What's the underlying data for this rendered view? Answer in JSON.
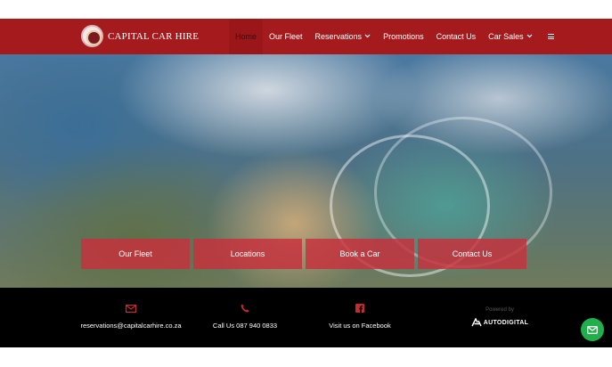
{
  "header": {
    "brand_name": "CAPITAL CAR HIRE",
    "nav": [
      {
        "label": "Home",
        "active": true
      },
      {
        "label": "Our Fleet"
      },
      {
        "label": "Reservations",
        "has_caret": true
      },
      {
        "label": "Promotions"
      },
      {
        "label": "Contact Us"
      },
      {
        "label": "Car Sales",
        "has_caret": true
      }
    ],
    "menu_icon": "hamburger-icon",
    "colors": {
      "bar": "#a51a1d"
    }
  },
  "hero": {
    "buttons": [
      {
        "label": "Our Fleet"
      },
      {
        "label": "Locations"
      },
      {
        "label": "Book a Car"
      },
      {
        "label": "Contact Us"
      }
    ],
    "button_color": "#c8303c"
  },
  "footer": {
    "email": {
      "icon": "envelope-icon",
      "text": "reservations@capitalcarhire.co.za"
    },
    "phone": {
      "icon": "phone-icon",
      "text": "Call Us 087 940 0833"
    },
    "facebook": {
      "icon": "facebook-icon",
      "text": "Visit us on Facebook"
    },
    "powered_by": "Powered by",
    "powered_brand": "AUTODIGITAL",
    "icon_color": "#c52b2f"
  },
  "fab": {
    "icon": "mail-icon",
    "color": "#20b04b"
  }
}
